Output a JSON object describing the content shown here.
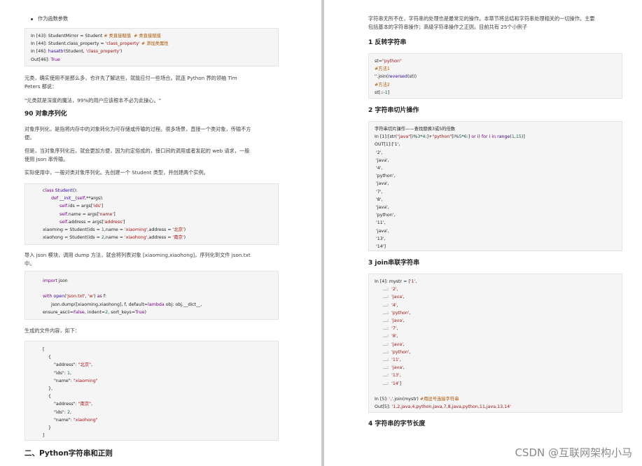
{
  "left": {
    "bullet": "作为函数参数",
    "code1": [
      [
        {
          "t": "In [43]: StudentMirror = Student "
        },
        {
          "t": "# 类直接赋值  # 类直接赋值",
          "c": "cm"
        }
      ],
      [
        {
          "t": "In [44]: Student.class_property = "
        },
        {
          "t": "'class_property'",
          "c": "st"
        },
        {
          "t": " "
        },
        {
          "t": "# 添加类属性",
          "c": "cm"
        }
      ],
      [
        {
          "t": "In [46]: "
        },
        {
          "t": "hasattr",
          "c": "bi"
        },
        {
          "t": "(Student, "
        },
        {
          "t": "'class_property'",
          "c": "st"
        },
        {
          "t": ")"
        }
      ],
      [
        {
          "t": "Out[46]: "
        },
        {
          "t": "True",
          "c": "kw"
        }
      ]
    ],
    "para1": "元类，确实使用不是那么多，也许先了解这些，就能应付一些场合。就连 Python 界的领袖 Tim\nPeters 都说：",
    "quote": "\"元类就是深度的魔法，99%的用户应该根本不必为此操心。\"",
    "heading90": "90 对象序列化",
    "para2": "对象序列化，是指将内存中的对象转化为可存储或传输的过程。很多场景，直接一个类对象，传输不方\n便。",
    "para3": "但是，当对象序列化后，就会更加方便，因为约定俗成的，接口间的调用或者发起的 web 请求，一般\n使用 json 串传输。",
    "para4": "实际使用中，一般对类对象序列化。先创建一个 Student 类型，并创建两个实例。",
    "code2": [
      [
        {
          "t": "class ",
          "c": "kw"
        },
        {
          "t": "Student",
          "c": "bi"
        },
        {
          "t": "():"
        }
      ],
      [
        {
          "t": "      "
        },
        {
          "t": "def ",
          "c": "kw"
        },
        {
          "t": "__init__",
          "c": "bi"
        },
        {
          "t": "("
        },
        {
          "t": "self",
          "c": "kw"
        },
        {
          "t": ",**args):"
        }
      ],
      [
        {
          "t": "            "
        },
        {
          "t": "self",
          "c": "kw"
        },
        {
          "t": ".ids = args["
        },
        {
          "t": "'ids'",
          "c": "st"
        },
        {
          "t": "]"
        }
      ],
      [
        {
          "t": "            "
        },
        {
          "t": "self",
          "c": "kw"
        },
        {
          "t": ".name = args["
        },
        {
          "t": "'name'",
          "c": "st"
        },
        {
          "t": "]"
        }
      ],
      [
        {
          "t": "            "
        },
        {
          "t": "self",
          "c": "kw"
        },
        {
          "t": ".address = args["
        },
        {
          "t": "'address'",
          "c": "st"
        },
        {
          "t": "]"
        }
      ],
      [
        {
          "t": "xiaoming = Student(ids = "
        },
        {
          "t": "1",
          "c": "nm"
        },
        {
          "t": ",name = "
        },
        {
          "t": "'xiaoming'",
          "c": "st"
        },
        {
          "t": ",address = "
        },
        {
          "t": "'北京'",
          "c": "st"
        },
        {
          "t": ")"
        }
      ],
      [
        {
          "t": "xiaohong = Student(ids = "
        },
        {
          "t": "2",
          "c": "nm"
        },
        {
          "t": ",name = "
        },
        {
          "t": "'xiaohong'",
          "c": "st"
        },
        {
          "t": ",address = "
        },
        {
          "t": "'南京'",
          "c": "st"
        },
        {
          "t": ")"
        }
      ]
    ],
    "para5": "导入 json 模块，调用 dump 方法，就会将列表对象 [xiaoming,xiaohong]，序列化到文件 json.txt\n中。",
    "code3": [
      [
        {
          "t": "import ",
          "c": "kw"
        },
        {
          "t": "json"
        }
      ],
      [
        {
          "t": ""
        }
      ],
      [
        {
          "t": "with ",
          "c": "kw"
        },
        {
          "t": "open",
          "c": "bi"
        },
        {
          "t": "("
        },
        {
          "t": "'json.txt'",
          "c": "st"
        },
        {
          "t": ", "
        },
        {
          "t": "'w'",
          "c": "st"
        },
        {
          "t": ") "
        },
        {
          "t": "as ",
          "c": "kw"
        },
        {
          "t": "f:"
        }
      ],
      [
        {
          "t": "      json.dump([xiaoming,xiaohong], f, default="
        },
        {
          "t": "lambda ",
          "c": "kw"
        },
        {
          "t": "obj: obj.__dict__,"
        }
      ],
      [
        {
          "t": "ensure_ascii="
        },
        {
          "t": "False",
          "c": "kw"
        },
        {
          "t": ", indent="
        },
        {
          "t": "2",
          "c": "nm"
        },
        {
          "t": ", sort_keys="
        },
        {
          "t": "True",
          "c": "kw"
        },
        {
          "t": ")"
        }
      ]
    ],
    "para6": "生成的文件内容，如下：",
    "code4": [
      [
        {
          "t": "["
        }
      ],
      [
        {
          "t": "    {"
        }
      ],
      [
        {
          "t": "        \"address\": "
        },
        {
          "t": "\"北京\"",
          "c": "st"
        },
        {
          "t": ","
        }
      ],
      [
        {
          "t": "        \"ids\": "
        },
        {
          "t": "1",
          "c": "nm"
        },
        {
          "t": ","
        }
      ],
      [
        {
          "t": "        \"name\": "
        },
        {
          "t": "\"xiaoming\"",
          "c": "st"
        }
      ],
      [
        {
          "t": "    },"
        }
      ],
      [
        {
          "t": "    {"
        }
      ],
      [
        {
          "t": "        \"address\": "
        },
        {
          "t": "\"南京\"",
          "c": "st"
        },
        {
          "t": ","
        }
      ],
      [
        {
          "t": "        \"ids\": "
        },
        {
          "t": "2",
          "c": "nm"
        },
        {
          "t": ","
        }
      ],
      [
        {
          "t": "        \"name\": "
        },
        {
          "t": "\"xiaohong\"",
          "c": "st"
        }
      ],
      [
        {
          "t": "    }"
        }
      ],
      [
        {
          "t": "]"
        }
      ]
    ],
    "section_heading": "二、Python字符串和正则"
  },
  "right": {
    "intro": "字符串无所不在，字符串的处理也是最常见的操作。本章节将总结和字符串处理相关的一切操作。主要\n包括基本的字符串操作；高级字符串操作之正则。目前共有 25个小例子",
    "heading1": "1 反转字符串",
    "code1": [
      [
        {
          "t": "st="
        },
        {
          "t": "\"python\"",
          "c": "st"
        }
      ],
      [
        {
          "t": "#方法1",
          "c": "cm"
        }
      ],
      [
        {
          "t": "''.join("
        },
        {
          "t": "reversed",
          "c": "bi"
        },
        {
          "t": "(st))"
        }
      ],
      [
        {
          "t": "#方法2",
          "c": "cm"
        }
      ],
      [
        {
          "t": "st[::-"
        },
        {
          "t": "1",
          "c": "nm"
        },
        {
          "t": "]"
        }
      ]
    ],
    "heading2": "2 字符串切片操作",
    "code2": [
      [
        {
          "t": "字符串切片操作——查找替换3或5的倍数"
        }
      ],
      [
        {
          "t": "In [1]:[str("
        },
        {
          "t": "\"java\"",
          "c": "st"
        },
        {
          "t": "[i%"
        },
        {
          "t": "3",
          "c": "nm"
        },
        {
          "t": "*"
        },
        {
          "t": "4",
          "c": "nm"
        },
        {
          "t": ":]+"
        },
        {
          "t": "\"python\"",
          "c": "st"
        },
        {
          "t": "[i%"
        },
        {
          "t": "5",
          "c": "nm"
        },
        {
          "t": "*"
        },
        {
          "t": "6",
          "c": "nm"
        },
        {
          "t": ":] "
        },
        {
          "t": "or ",
          "c": "kw"
        },
        {
          "t": "i) "
        },
        {
          "t": "for ",
          "c": "kw"
        },
        {
          "t": "i "
        },
        {
          "t": "in ",
          "c": "kw"
        },
        {
          "t": "range",
          "c": "bi"
        },
        {
          "t": "("
        },
        {
          "t": "1",
          "c": "nm"
        },
        {
          "t": ","
        },
        {
          "t": "15",
          "c": "nm"
        },
        {
          "t": ")]"
        }
      ],
      [
        {
          "t": "OUT[1]:['1',"
        }
      ],
      [
        {
          "t": " '2',"
        }
      ],
      [
        {
          "t": " 'java',"
        }
      ],
      [
        {
          "t": " '4',"
        }
      ],
      [
        {
          "t": " 'python',"
        }
      ],
      [
        {
          "t": " 'java',"
        }
      ],
      [
        {
          "t": " '7',"
        }
      ],
      [
        {
          "t": " '8',"
        }
      ],
      [
        {
          "t": " 'java',"
        }
      ],
      [
        {
          "t": " 'python',"
        }
      ],
      [
        {
          "t": " '11',"
        }
      ],
      [
        {
          "t": " 'java',"
        }
      ],
      [
        {
          "t": " '13',"
        }
      ],
      [
        {
          "t": " '14']"
        }
      ]
    ],
    "heading3": "3 join串联字符串",
    "code3": [
      [
        {
          "t": "In [4]: mystr = ["
        },
        {
          "t": "'1'",
          "c": "st"
        },
        {
          "t": ","
        }
      ],
      [
        {
          "t": "      ...:  "
        },
        {
          "t": "'2'",
          "c": "st"
        },
        {
          "t": ","
        }
      ],
      [
        {
          "t": "      ...:  "
        },
        {
          "t": "'java'",
          "c": "st"
        },
        {
          "t": ","
        }
      ],
      [
        {
          "t": "      ...:  "
        },
        {
          "t": "'4'",
          "c": "st"
        },
        {
          "t": ","
        }
      ],
      [
        {
          "t": "      ...:  "
        },
        {
          "t": "'python'",
          "c": "st"
        },
        {
          "t": ","
        }
      ],
      [
        {
          "t": "      ...:  "
        },
        {
          "t": "'java'",
          "c": "st"
        },
        {
          "t": ","
        }
      ],
      [
        {
          "t": "      ...:  "
        },
        {
          "t": "'7'",
          "c": "st"
        },
        {
          "t": ","
        }
      ],
      [
        {
          "t": "      ...:  "
        },
        {
          "t": "'8'",
          "c": "st"
        },
        {
          "t": ","
        }
      ],
      [
        {
          "t": "      ...:  "
        },
        {
          "t": "'java'",
          "c": "st"
        },
        {
          "t": ","
        }
      ],
      [
        {
          "t": "      ...:  "
        },
        {
          "t": "'python'",
          "c": "st"
        },
        {
          "t": ","
        }
      ],
      [
        {
          "t": "      ...:  "
        },
        {
          "t": "'11'",
          "c": "st"
        },
        {
          "t": ","
        }
      ],
      [
        {
          "t": "      ...:  "
        },
        {
          "t": "'java'",
          "c": "st"
        },
        {
          "t": ","
        }
      ],
      [
        {
          "t": "      ...:  "
        },
        {
          "t": "'13'",
          "c": "st"
        },
        {
          "t": ","
        }
      ],
      [
        {
          "t": "      ...:  "
        },
        {
          "t": "'14'",
          "c": "st"
        },
        {
          "t": "]"
        }
      ],
      [
        {
          "t": ""
        }
      ],
      [
        {
          "t": "In [5]: "
        },
        {
          "t": "','",
          "c": "st"
        },
        {
          "t": ".join(mystr) "
        },
        {
          "t": "#用逗号连接字符串",
          "c": "cm"
        }
      ],
      [
        {
          "t": "Out[5]: "
        },
        {
          "t": "'1,2,java,4,python,java,7,8,java,python,11,java,13,14'",
          "c": "st"
        }
      ]
    ],
    "heading4": "4 字符串的字节长度"
  },
  "watermark": "CSDN @互联网架构小马",
  "colors": {
    "keyword": "#770088",
    "builtin": "#3300aa",
    "string": "#aa1111",
    "comment": "#aa5500",
    "number": "#116644",
    "code_bg": "#f5f5f5"
  }
}
